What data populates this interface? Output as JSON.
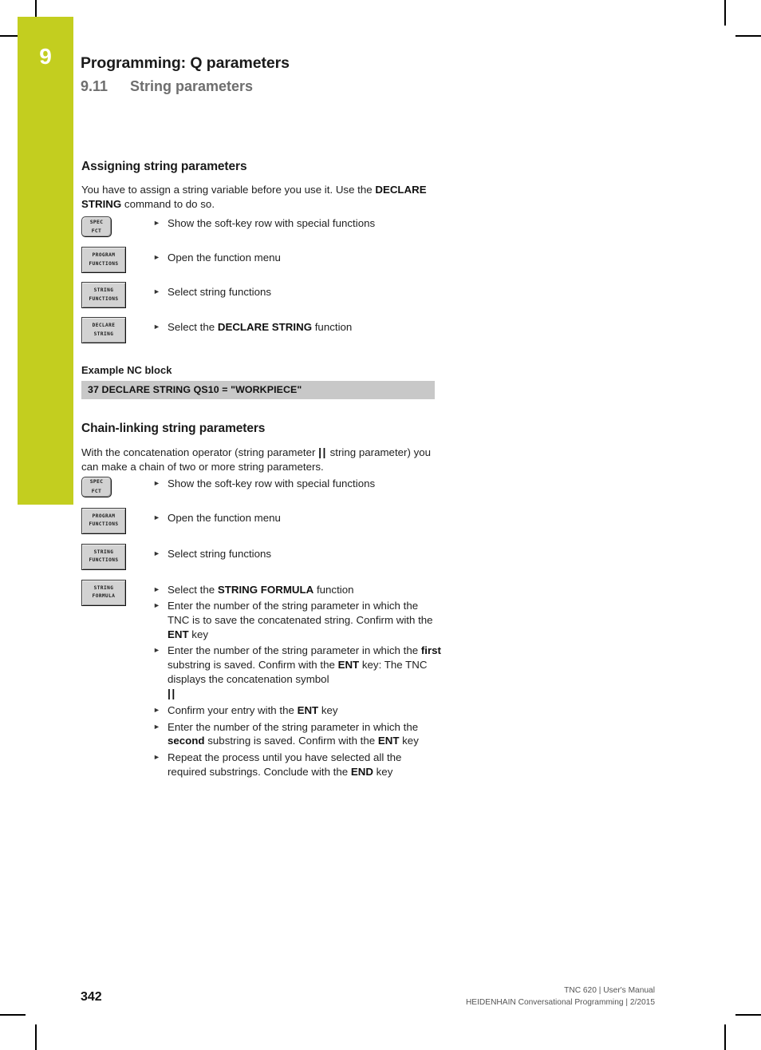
{
  "chapter": {
    "number": "9",
    "accent_color": "#c3ce1f"
  },
  "header": {
    "title": "Programming: Q parameters",
    "section_number": "9.11",
    "section_title": "String parameters"
  },
  "sections": [
    {
      "title": "Assigning string parameters",
      "intro_plain_1": "You have to assign a string variable before you use it. Use the ",
      "intro_bold": "DECLARE STRING",
      "intro_plain_2": " command to do so.",
      "steps": [
        {
          "key_line1": "SPEC",
          "key_line2": "FCT",
          "key_shape": "rounded",
          "text": "Show the soft-key row with special functions"
        },
        {
          "key_line1": "PROGRAM",
          "key_line2": "FUNCTIONS",
          "key_shape": "square",
          "text": "Open the function menu"
        },
        {
          "key_line1": "STRING",
          "key_line2": "FUNCTIONS",
          "key_shape": "square",
          "text": "Select string functions"
        },
        {
          "key_line1": "DECLARE",
          "key_line2": "STRING",
          "key_shape": "square",
          "text_pre": "Select the ",
          "text_bold": "DECLARE STRING",
          "text_post": " function"
        }
      ],
      "example_label": "Example NC block",
      "example_code": "37 DECLARE STRING QS10 = \"WORKPIECE\""
    },
    {
      "title": "Chain-linking string parameters",
      "intro_plain_1": "With the concatenation operator (string parameter ",
      "intro_symbol": "||",
      "intro_plain_2": " string parameter) you can make a chain of two or more string parameters.",
      "steps": [
        {
          "key_line1": "SPEC",
          "key_line2": "FCT",
          "key_shape": "rounded",
          "text": "Show the soft-key row with special functions"
        },
        {
          "key_line1": "PROGRAM",
          "key_line2": "FUNCTIONS",
          "key_shape": "square",
          "text": "Open the function menu"
        },
        {
          "key_line1": "STRING",
          "key_line2": "FUNCTIONS",
          "key_shape": "square",
          "text": "Select string functions"
        }
      ],
      "formula_key": {
        "key_line1": "STRING",
        "key_line2": "FORMULA",
        "key_shape": "square"
      },
      "instructions": [
        {
          "segments": [
            {
              "t": "Select the ",
              "b": false
            },
            {
              "t": "STRING FORMULA",
              "b": true
            },
            {
              "t": " function",
              "b": false
            }
          ]
        },
        {
          "segments": [
            {
              "t": "Enter the number of the string parameter in which the TNC is to save the concatenated string. Confirm with the ",
              "b": false
            },
            {
              "t": "ENT",
              "b": true
            },
            {
              "t": " key",
              "b": false
            }
          ]
        },
        {
          "segments": [
            {
              "t": "Enter the number of the string parameter in which the ",
              "b": false
            },
            {
              "t": "first",
              "b": true
            },
            {
              "t": " substring is saved. Confirm with the ",
              "b": false
            },
            {
              "t": "ENT",
              "b": true
            },
            {
              "t": " key: The TNC displays the concatenation symbol ",
              "b": false
            }
          ],
          "trailing_symbol": "||"
        },
        {
          "segments": [
            {
              "t": "Confirm your entry with the ",
              "b": false
            },
            {
              "t": "ENT",
              "b": true
            },
            {
              "t": " key",
              "b": false
            }
          ]
        },
        {
          "segments": [
            {
              "t": "Enter the number of the string parameter in which the ",
              "b": false
            },
            {
              "t": "second",
              "b": true
            },
            {
              "t": " substring is saved. Confirm with the ",
              "b": false
            },
            {
              "t": "ENT",
              "b": true
            },
            {
              "t": " key",
              "b": false
            }
          ]
        },
        {
          "segments": [
            {
              "t": "Repeat the process until you have selected all the required substrings. Conclude with the ",
              "b": false
            },
            {
              "t": "END",
              "b": true
            },
            {
              "t": " key",
              "b": false
            }
          ]
        }
      ]
    }
  ],
  "footer": {
    "page_number": "342",
    "line1": "TNC 620 | User's Manual",
    "line2": "HEIDENHAIN Conversational Programming | 2/2015"
  }
}
